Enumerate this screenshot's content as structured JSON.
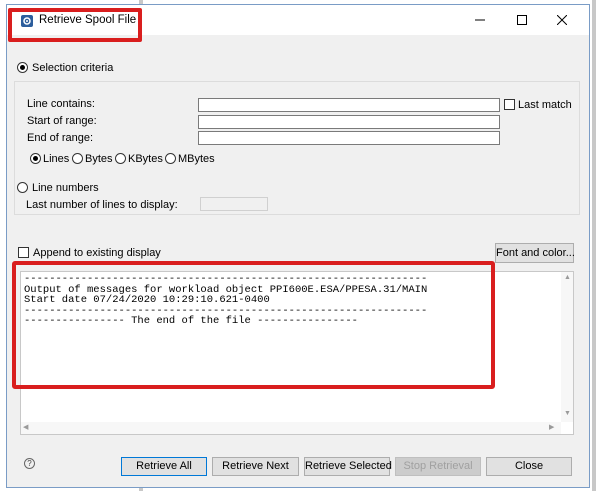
{
  "window": {
    "title": "Retrieve Spool File"
  },
  "selection": {
    "label": "Selection criteria",
    "line_contains_label": "Line contains:",
    "line_contains_value": "",
    "last_match_label": "Last match",
    "start_of_range_label": "Start of range:",
    "start_of_range_value": "",
    "end_of_range_label": "End of range:",
    "end_of_range_value": "",
    "units": [
      "Lines",
      "Bytes",
      "KBytes",
      "MBytes"
    ],
    "selected_unit": "Lines"
  },
  "line_numbers": {
    "label": "Line numbers",
    "last_lines_label": "Last number of lines to display:",
    "last_lines_value": ""
  },
  "append_label": "Append to existing display",
  "font_button": "Font and color...",
  "output": {
    "lines": [
      "----------------------------------------------------------------",
      "Output of messages for workload object PPI600E.ESA/PPESA.31/MAIN",
      "Start date 07/24/2020 10:29:10.621-0400",
      "----------------------------------------------------------------",
      "---------------- The end of the file ----------------"
    ]
  },
  "buttons": {
    "retrieve_all": "Retrieve All",
    "retrieve_next": "Retrieve Next",
    "retrieve_selected": "Retrieve Selected",
    "stop_retrieval": "Stop Retrieval",
    "close": "Close"
  },
  "help_glyph": "?",
  "colors": {
    "annotation": "#d91e1e",
    "title_icon": "#2c5d9c",
    "dialog_bg": "#f0f0f0"
  }
}
